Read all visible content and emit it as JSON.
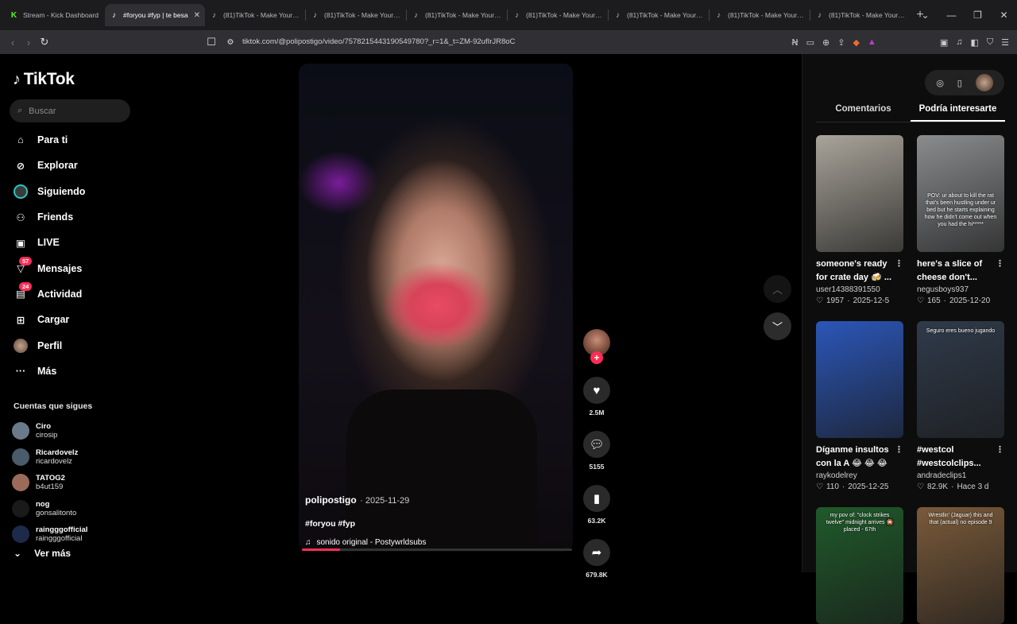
{
  "browser": {
    "tabs": [
      {
        "title": "Stream - Kick Dashboard",
        "icon": "kick-icon",
        "active": false
      },
      {
        "title": "#foryou #fyp | te besa",
        "icon": "tiktok-icon",
        "active": true
      },
      {
        "title": "(81)TikTok - Make Your Da",
        "icon": "tiktok-icon",
        "active": false
      },
      {
        "title": "(81)TikTok - Make Your Da",
        "icon": "tiktok-icon",
        "active": false
      },
      {
        "title": "(81)TikTok - Make Your Da",
        "icon": "tiktok-icon",
        "active": false
      },
      {
        "title": "(81)TikTok - Make Your Da",
        "icon": "tiktok-icon",
        "active": false
      },
      {
        "title": "(81)TikTok - Make Your Da",
        "icon": "tiktok-icon",
        "active": false
      },
      {
        "title": "(81)TikTok - Make Your Da",
        "icon": "tiktok-icon",
        "active": false
      },
      {
        "title": "(81)TikTok - Make Your Da",
        "icon": "tiktok-icon",
        "active": false
      }
    ],
    "url": "tiktok.com/@polipostigo/video/7578215443190549780?_r=1&_t=ZM-92ufIrJR8oC"
  },
  "sidebar": {
    "logo": "TikTok",
    "search_placeholder": "Buscar",
    "nav": [
      {
        "label": "Para ti",
        "icon": "home-icon"
      },
      {
        "label": "Explorar",
        "icon": "compass-icon"
      },
      {
        "label": "Siguiendo",
        "icon": "following-avatar-icon"
      },
      {
        "label": "Friends",
        "icon": "friends-icon"
      },
      {
        "label": "LIVE",
        "icon": "live-icon"
      },
      {
        "label": "Mensajes",
        "icon": "inbox-icon",
        "badge": "57"
      },
      {
        "label": "Actividad",
        "icon": "activity-icon",
        "badge": "24"
      },
      {
        "label": "Cargar",
        "icon": "upload-icon"
      },
      {
        "label": "Perfil",
        "icon": "profile-avatar-icon"
      },
      {
        "label": "Más",
        "icon": "more-dots-icon"
      }
    ],
    "following_title": "Cuentas que sigues",
    "following": [
      {
        "name": "Ciro",
        "handle": "cirosip",
        "color": "#6b7a8a"
      },
      {
        "name": "Ricardovelz",
        "handle": "ricardovelz",
        "color": "#4a5b6a"
      },
      {
        "name": "TATOG2",
        "handle": "b4ut159",
        "color": "#9b6b5a"
      },
      {
        "name": "nog",
        "handle": "gonsalitonto",
        "color": "#1a1a1a"
      },
      {
        "name": "raingggofficial",
        "handle": "raingggofficial",
        "color": "#1e2a4a"
      }
    ],
    "see_more": "Ver más"
  },
  "video": {
    "author": "polipostigo",
    "date": "· 2025-11-29",
    "hashtags": "#foryou #fyp",
    "sound": "sonido original - Postywrldsubs",
    "progress": 0.14,
    "likes": "2.5M",
    "comments": "5155",
    "saves": "63.2K",
    "shares": "679.8K"
  },
  "right_panel": {
    "tabs": [
      "Comentarios",
      "Podría interesarte"
    ],
    "active_tab": 1,
    "cards": [
      {
        "title": "someone's ready for crate day 🍻 ...",
        "user": "user14388391550",
        "likes": "1957",
        "date": "2025-12-5",
        "caption": "",
        "bg": "#a9a49a"
      },
      {
        "title": "here's a slice of cheese don't...",
        "user": "negusboys937",
        "likes": "165",
        "date": "2025-12-20",
        "caption": "POV: ur about to kill the rat that's been hustling under ur bed but he starts explaining how he didn't come out when you had the hi*****",
        "bg": "#8a8c8e"
      },
      {
        "title": "Díganme insultos con la A 😂 😂 😂 ...",
        "user": "raykodelrey",
        "likes": "110",
        "date": "2025-12-25",
        "caption": "",
        "bg": "#2b56b8"
      },
      {
        "title": "#westcol #westcolclips...",
        "user": "andradeclips1",
        "likes": "82.9K",
        "date": "Hace 3 d",
        "caption": "Seguro eres bueno jugando",
        "bg": "#2f3a4a"
      },
      {
        "title": "",
        "user": "",
        "likes": "",
        "date": "",
        "caption": "my pov of: \"clock strikes twelve\" midnight arrives 🎇 placed - 67th",
        "bg": "#1f5a2a"
      },
      {
        "title": "",
        "user": "",
        "likes": "",
        "date": "",
        "caption": "Wrestlin' (Jaguar) this and that (actual) no episode 9",
        "bg": "#7a5a3a"
      }
    ]
  },
  "colors": {
    "accent": "#fe2c55",
    "bg": "#000000",
    "panel": "#0d0d0d"
  }
}
